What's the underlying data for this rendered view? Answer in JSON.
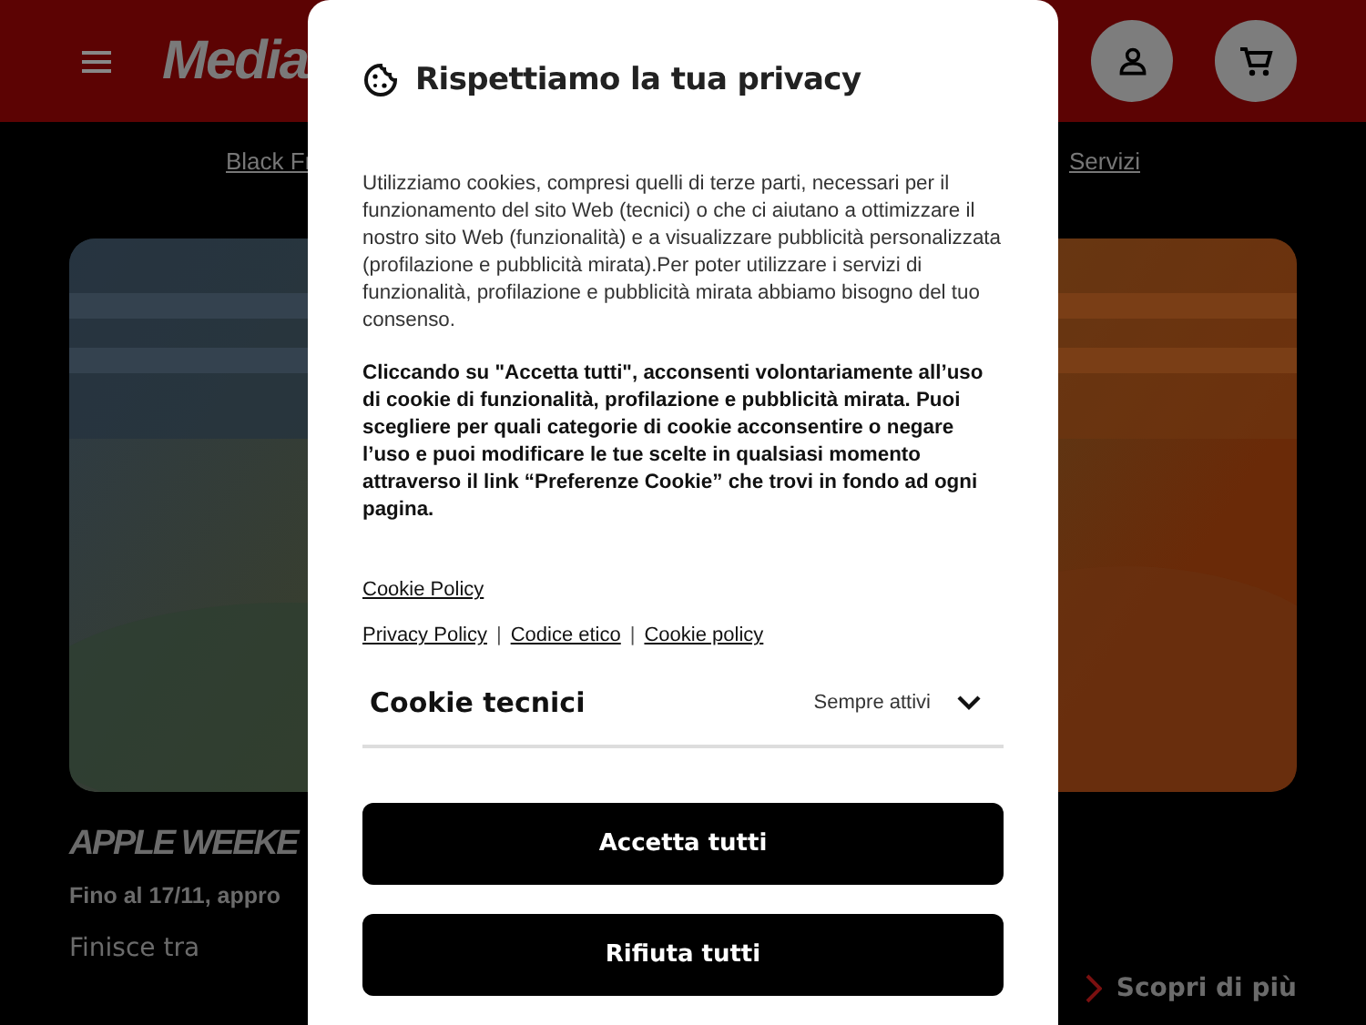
{
  "header": {
    "logo": "Media"
  },
  "nav": {
    "links": [
      "Black Fr",
      "Servizi"
    ]
  },
  "promo": {
    "title": "APPLE WEEKE",
    "subtitle": "Fino al 17/11, appro",
    "ends_label": "Finisce tra",
    "more_link": "Scopri di più"
  },
  "modal": {
    "title": "Rispettiamo la tua privacy",
    "intro": "Utilizziamo cookies, compresi quelli di terze parti, necessari per il funzionamento del sito Web (tecnici) o che ci aiutano a ottimizzare il nostro sito Web (funzionalità) e a visualizzare pubblicità personalizzata (profilazione e pubblicità mirata).Per poter utilizzare i servizi di funzionalità, profilazione e pubblicità mirata abbiamo bisogno del tuo consenso.",
    "consent": "Cliccando su \"Accetta tutti\", acconsenti volontariamente all’uso di cookie di funzionalità, profilazione e pubblicità mirata. Puoi scegliere per quali categorie di cookie acconsentire o negare l’uso e puoi modificare le tue scelte in qualsiasi momento attraverso il link “Preferenze Cookie” che trovi in fondo ad ogni pagina.",
    "cookie_policy": "Cookie Policy",
    "links": [
      "Privacy Policy",
      "Codice etico",
      "Cookie policy"
    ],
    "separators": [
      "|",
      "|"
    ],
    "categories": [
      {
        "name": "Cookie tecnici",
        "status": "Sempre attivi",
        "expanded": false
      }
    ],
    "buttons": [
      "Accetta tutti",
      "Rifiuta tutti"
    ]
  }
}
